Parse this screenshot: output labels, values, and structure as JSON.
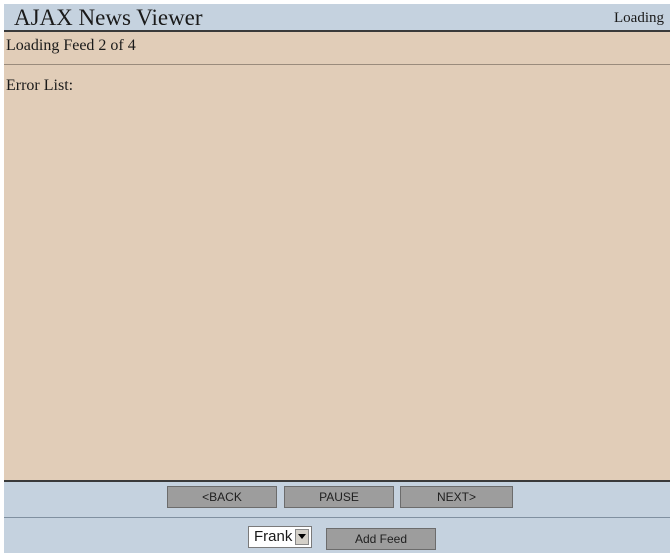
{
  "header": {
    "title": "AJAX News Viewer",
    "status": "Loading"
  },
  "main": {
    "feed_status": "Loading Feed 2 of 4",
    "error_list_label": "Error List:"
  },
  "controls": {
    "back_label": "<BACK",
    "pause_label": "PAUSE",
    "next_label": "NEXT>",
    "user_select_value": "Frank",
    "add_feed_label": "Add Feed"
  },
  "colors": {
    "header_bg": "#c5d2df",
    "content_bg": "#e1cdb8",
    "button_bg": "#9d9d9d"
  }
}
